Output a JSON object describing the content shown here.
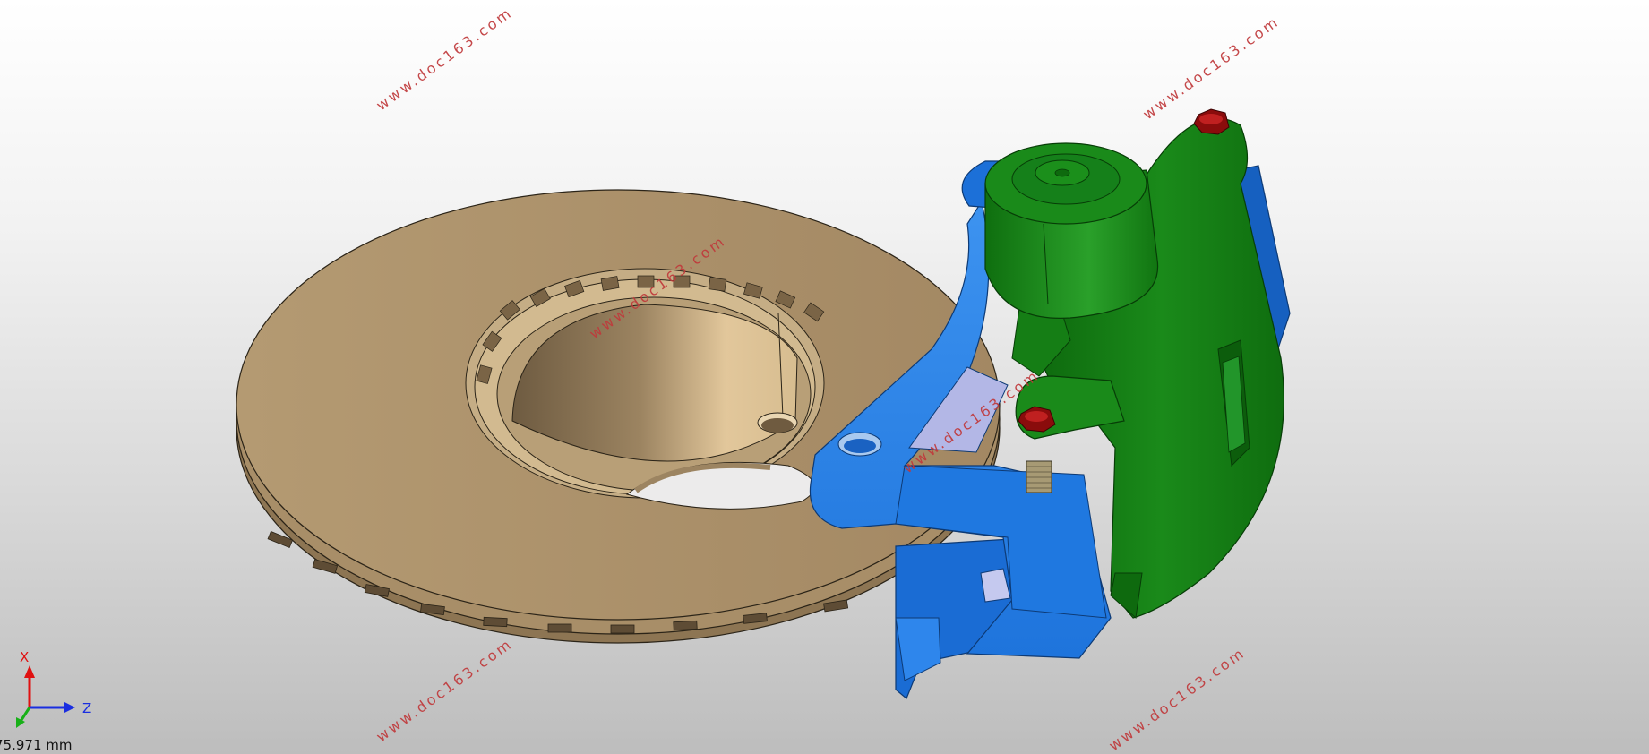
{
  "viewport": {
    "model": [
      {
        "part": "brake-disc",
        "color": "#a98f68"
      },
      {
        "part": "caliper-bracket",
        "color": "#2680e8"
      },
      {
        "part": "caliper-housing",
        "color": "#137a13"
      },
      {
        "part": "caliper-bolt",
        "color": "#8a0c0c"
      }
    ],
    "watermarks": [
      "www.doc163.com",
      "www.doc163.com",
      "www.doc163.com",
      "www.doc163.com",
      "www.doc163.com",
      "www.doc163.com"
    ],
    "axis_triad": {
      "x_label": "X",
      "z_label": "Z",
      "colors": {
        "x": "#e01010",
        "z": "#1a2ee0",
        "y": "#18b018"
      }
    },
    "scale": "75.971 mm"
  }
}
